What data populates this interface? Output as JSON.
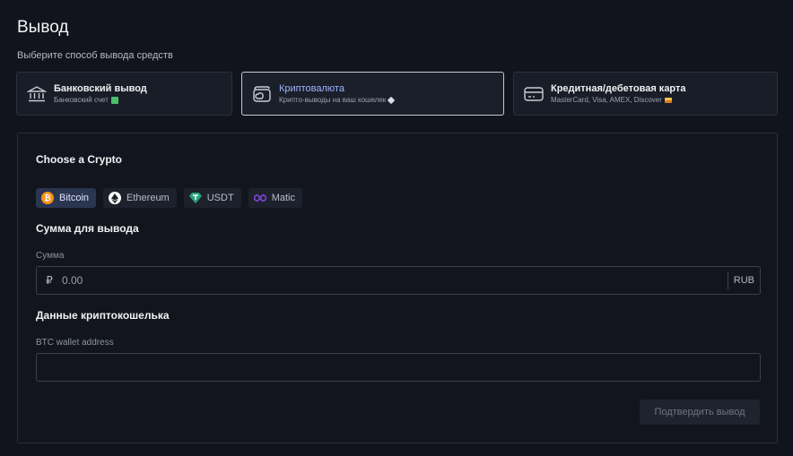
{
  "page": {
    "title": "Вывод",
    "subtitle": "Выберите способ вывода средств"
  },
  "methods": [
    {
      "title": "Банковский вывод",
      "desc": "Банковский счет",
      "icon": "bank-icon",
      "active": false
    },
    {
      "title": "Криптовалюта",
      "desc": "Крипто-выводы на ваш кошелек",
      "icon": "wallet-icon",
      "active": true
    },
    {
      "title": "Кредитная/дебетовая карта",
      "desc": "MasterCard, Visa, AMEX, Discover",
      "icon": "credit-card-icon",
      "active": false
    }
  ],
  "crypto_section": {
    "title": "Choose a Crypto",
    "options": [
      {
        "label": "Bitcoin",
        "icon": "bitcoin-icon",
        "color": "#f7931a",
        "active": true
      },
      {
        "label": "Ethereum",
        "icon": "ethereum-icon",
        "color": "#ffffff",
        "active": false
      },
      {
        "label": "USDT",
        "icon": "tether-icon",
        "color": "#26a17b",
        "active": false
      },
      {
        "label": "Matic",
        "icon": "polygon-icon",
        "color": "#8247e5",
        "active": false
      }
    ]
  },
  "amount_section": {
    "title": "Сумма для вывода",
    "label": "Сумма",
    "currency_symbol": "₽",
    "placeholder": "0.00",
    "value": "",
    "currency_code": "RUB"
  },
  "wallet_section": {
    "title": "Данные криптокошелька",
    "label": "BTC wallet address",
    "value": "",
    "placeholder": ""
  },
  "submit": {
    "label": "Подтвердить вывод"
  },
  "colors": {
    "background": "#11141c",
    "accent": "#9fb4ff",
    "active_chip": "#2a3550"
  }
}
